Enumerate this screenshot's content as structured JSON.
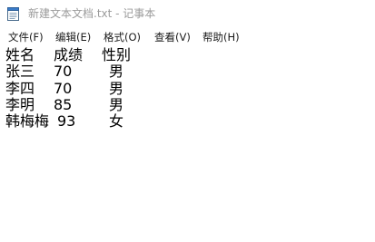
{
  "window": {
    "title": "新建文本文档.txt - 记事本",
    "icon": "notepad-icon"
  },
  "menu": {
    "file": "文件(F)",
    "edit": "编辑(E)",
    "format": "格式(O)",
    "view": "查看(V)",
    "help": "帮助(H)"
  },
  "document": {
    "header": [
      "姓名",
      "成绩",
      "性别"
    ],
    "rows": [
      [
        "张三",
        "70",
        "男"
      ],
      [
        "李四",
        "70",
        "男"
      ],
      [
        "李明",
        "85",
        "男"
      ],
      [
        "韩梅梅",
        "93",
        "女"
      ]
    ]
  }
}
